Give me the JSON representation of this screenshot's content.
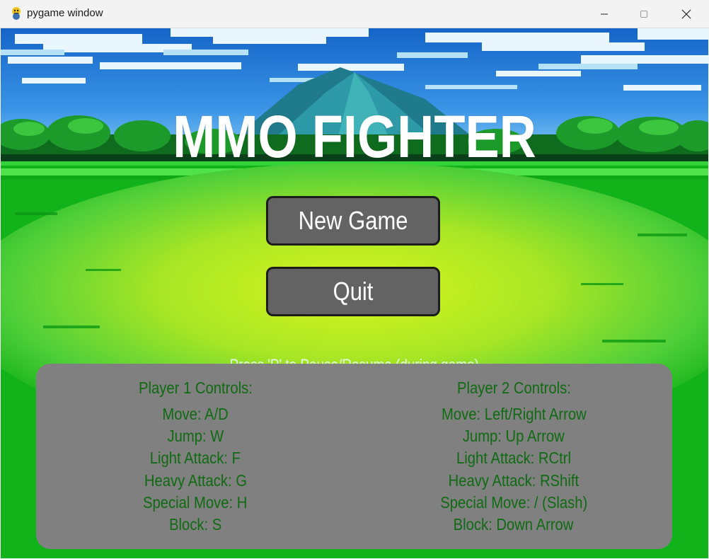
{
  "window": {
    "title": "pygame window",
    "icon": "pygame-snake-icon"
  },
  "game": {
    "title": "MMO FIGHTER",
    "buttons": {
      "new_game": "New Game",
      "quit": "Quit"
    },
    "pause_hint": "Press 'P' to Pause/Resume (during game)"
  },
  "controls": {
    "player1": {
      "header": "Player 1 Controls:",
      "lines": [
        "Move: A/D",
        "Jump: W",
        "Light Attack: F",
        "Heavy Attack: G",
        "Special Move: H",
        "Block: S"
      ]
    },
    "player2": {
      "header": "Player 2 Controls:",
      "lines": [
        "Move: Left/Right Arrow",
        "Jump: Up Arrow",
        "Light Attack: RCtrl",
        "Heavy Attack: RShift",
        "Special Move: / (Slash)",
        "Block: Down Arrow"
      ]
    }
  },
  "colors": {
    "button_fill": "#636363",
    "panel_fill": "#808080",
    "control_text": "#0f6a12",
    "sky": "#1f7fd6",
    "grass": "#0aa80a"
  }
}
